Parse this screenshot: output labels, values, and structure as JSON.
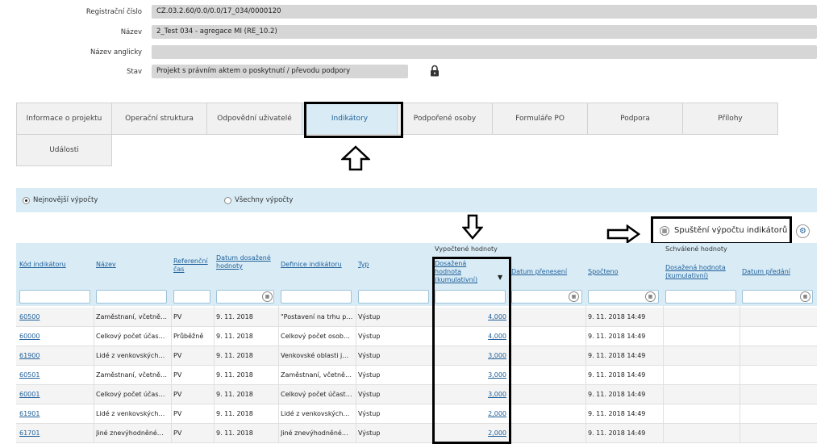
{
  "form": {
    "registration_label": "Registrační číslo",
    "registration_value": "CZ.03.2.60/0.0/0.0/17_034/0000120",
    "name_label": "Název",
    "name_value": "2_Test 034 - agregace MI (RE_10.2)",
    "name_en_label": "Název anglicky",
    "name_en_value": "",
    "state_label": "Stav",
    "state_value": "Projekt s právním aktem o poskytnutí / převodu podpory"
  },
  "tabs": [
    "Informace o projektu",
    "Operační struktura",
    "Odpovědní uživatelé",
    "Indikátory",
    "Podpořené osoby",
    "Formuláře PO",
    "Podpora",
    "Přílohy",
    "Události"
  ],
  "filter": {
    "latest_label": "Nejnovější výpočty",
    "all_label": "Všechny výpočty"
  },
  "calc_button_label": "Spuštění výpočtu indikátorů",
  "grid": {
    "group_computed": "Vypočtené hodnoty",
    "group_approved": "Schválené hodnoty",
    "columns": {
      "code": "Kód indikátoru",
      "name": "Název",
      "ref": "Referenční čas",
      "date_reached": "Datum dosažené hodnoty",
      "definition": "Definice indikátoru",
      "type": "Typ",
      "reached_cum": "Dosažená hodnota (kumulativní)",
      "date_transfer": "Datum přenesení",
      "computed": "Spočteno",
      "approved_cum": "Dosažená hodnota (kumulativní)",
      "date_handover": "Datum předání"
    },
    "rows": [
      {
        "code": "60500",
        "name": "Zaměstnaní, včetně…",
        "ref": "PV",
        "date": "9. 11. 2018",
        "def": "\"Postavení na trhu p…",
        "type": "Výstup",
        "value": "4,000",
        "computed": "9. 11. 2018 14:49"
      },
      {
        "code": "60000",
        "name": "Celkový počet účast…",
        "ref": "Průběžně",
        "date": "9. 11. 2018",
        "def": "Celkový počet osob…",
        "type": "Výstup",
        "value": "4,000",
        "computed": "9. 11. 2018 14:49"
      },
      {
        "code": "61900",
        "name": "Lidé z venkovských…",
        "ref": "PV",
        "date": "9. 11. 2018",
        "def": "Venkovské oblasti j…",
        "type": "Výstup",
        "value": "3,000",
        "computed": "9. 11. 2018 14:49"
      },
      {
        "code": "60501",
        "name": "Zaměstnaní, včetně…",
        "ref": "PV",
        "date": "9. 11. 2018",
        "def": "Zaměstnaní, včetně…",
        "type": "Výstup",
        "value": "3,000",
        "computed": "9. 11. 2018 14:49"
      },
      {
        "code": "60001",
        "name": "Celkový počet účast…",
        "ref": "PV",
        "date": "9. 11. 2018",
        "def": "Celkový počet účast…",
        "type": "Výstup",
        "value": "3,000",
        "computed": "9. 11. 2018 14:49"
      },
      {
        "code": "61901",
        "name": "Lidé z venkovských…",
        "ref": "PV",
        "date": "9. 11. 2018",
        "def": "Lidé z venkovských…",
        "type": "Výstup",
        "value": "2,000",
        "computed": "9. 11. 2018 14:49"
      },
      {
        "code": "61701",
        "name": "Jiné znevýhodněné…",
        "ref": "PV",
        "date": "9. 11. 2018",
        "def": "Jiné znevýhodněné…",
        "type": "Výstup",
        "value": "2,000",
        "computed": "9. 11. 2018 14:49"
      }
    ]
  }
}
